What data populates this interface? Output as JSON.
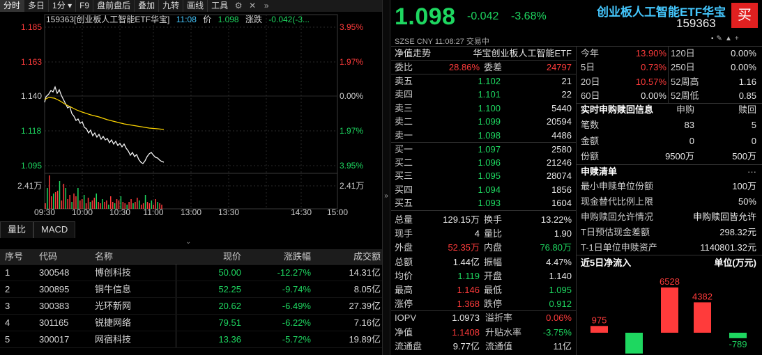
{
  "toolbar": {
    "items": [
      "分时",
      "多日",
      "1分",
      "F9",
      "盘前盘后",
      "叠加",
      "九转",
      "画线",
      "工具"
    ],
    "dropdown_indicator": "▾"
  },
  "chart": {
    "code_name": "159363[创业板人工智能ETF华宝]",
    "time": "11:08",
    "price_label": "价",
    "price_value": "1.098",
    "change_label": "涨跌",
    "change_value": "-0.042(-3...",
    "y_left": [
      "1.185",
      "1.163",
      "1.140",
      "1.118",
      "1.095"
    ],
    "y_right": [
      "3.95%",
      "1.97%",
      "0.00%",
      "1.97%",
      "3.95%"
    ],
    "vol_left": "2.41万",
    "vol_right": "2.41万",
    "x_labels": [
      "09:30",
      "10:00",
      "10:30",
      "11:00",
      "13:00",
      "13:30",
      "14:30",
      "15:00"
    ]
  },
  "indicator_tabs": [
    "量比",
    "MACD"
  ],
  "list": {
    "headers": [
      "序号",
      "代码",
      "名称",
      "现价",
      "涨跌幅",
      "成交额"
    ],
    "rows": [
      {
        "no": "1",
        "code": "300548",
        "name": "博创科技",
        "price": "50.00",
        "chg": "-12.27%",
        "amt": "14.31亿"
      },
      {
        "no": "2",
        "code": "300895",
        "name": "铜牛信息",
        "price": "52.25",
        "chg": "-9.74%",
        "amt": "8.05亿"
      },
      {
        "no": "3",
        "code": "300383",
        "name": "光环新网",
        "price": "20.62",
        "chg": "-6.49%",
        "amt": "27.39亿"
      },
      {
        "no": "4",
        "code": "301165",
        "name": "锐捷网络",
        "price": "79.51",
        "chg": "-6.22%",
        "amt": "7.16亿"
      },
      {
        "no": "5",
        "code": "300017",
        "name": "网宿科技",
        "price": "13.36",
        "chg": "-5.72%",
        "amt": "19.89亿"
      }
    ]
  },
  "quote": {
    "price": "1.098",
    "change": "-0.042",
    "pct": "-3.68%",
    "name": "创业板人工智能ETF华宝",
    "code": "159363",
    "buy_button": "买",
    "meta": "SZSE   CNY   11:08:27   交易中"
  },
  "orderbook": {
    "header_left": "净值走势",
    "header_right": "华宝创业板人工智能ETF",
    "weibi_label": "委比",
    "weibi_value": "28.86%",
    "weicha_label": "委差",
    "weicha_value": "24797",
    "asks": [
      {
        "label": "卖五",
        "price": "1.102",
        "vol": "21"
      },
      {
        "label": "卖四",
        "price": "1.101",
        "vol": "22"
      },
      {
        "label": "卖三",
        "price": "1.100",
        "vol": "5440"
      },
      {
        "label": "卖二",
        "price": "1.099",
        "vol": "20594"
      },
      {
        "label": "卖一",
        "price": "1.098",
        "vol": "4486"
      }
    ],
    "bids": [
      {
        "label": "买一",
        "price": "1.097",
        "vol": "2580"
      },
      {
        "label": "买二",
        "price": "1.096",
        "vol": "21246"
      },
      {
        "label": "买三",
        "price": "1.095",
        "vol": "28074"
      },
      {
        "label": "买四",
        "price": "1.094",
        "vol": "1856"
      },
      {
        "label": "买五",
        "price": "1.093",
        "vol": "1604"
      }
    ]
  },
  "stats": [
    {
      "l1": "总量",
      "v1": "129.15万",
      "c1": "w",
      "l2": "换手",
      "v2": "13.22%",
      "c2": "w"
    },
    {
      "l1": "现手",
      "v1": "4",
      "c1": "w",
      "l2": "量比",
      "v2": "1.90",
      "c2": "w"
    },
    {
      "l1": "外盘",
      "v1": "52.35万",
      "c1": "r",
      "l2": "内盘",
      "v2": "76.80万",
      "c2": "g"
    },
    {
      "l1": "总额",
      "v1": "1.44亿",
      "c1": "w",
      "l2": "振幅",
      "v2": "4.47%",
      "c2": "w"
    },
    {
      "l1": "均价",
      "v1": "1.119",
      "c1": "g",
      "l2": "开盘",
      "v2": "1.140",
      "c2": "w"
    },
    {
      "l1": "最高",
      "v1": "1.146",
      "c1": "r",
      "l2": "最低",
      "v2": "1.095",
      "c2": "g"
    },
    {
      "l1": "涨停",
      "v1": "1.368",
      "c1": "r",
      "l2": "跌停",
      "v2": "0.912",
      "c2": "g"
    }
  ],
  "iopv": [
    {
      "l1": "IOPV",
      "v1": "1.0973",
      "c1": "w",
      "l2": "溢折率",
      "v2": "0.06%",
      "c2": "r"
    },
    {
      "l1": "净值",
      "v1": "1.1408",
      "c1": "r",
      "l2": "升贴水率",
      "v2": "-3.75%",
      "c2": "g"
    },
    {
      "l1": "流通盘",
      "v1": "9.77亿",
      "c1": "w",
      "l2": "流通值",
      "v2": "11亿",
      "c2": "w"
    }
  ],
  "perf": [
    {
      "l1": "今年",
      "v1": "13.90%",
      "c1": "r",
      "l2": "120日",
      "v2": "0.00%",
      "c2": "w"
    },
    {
      "l1": "5日",
      "v1": "0.73%",
      "c1": "r",
      "l2": "250日",
      "v2": "0.00%",
      "c2": "w"
    },
    {
      "l1": "20日",
      "v1": "10.57%",
      "c1": "r",
      "l2": "52周高",
      "v2": "1.16",
      "c2": "w"
    },
    {
      "l1": "60日",
      "v1": "0.00%",
      "c1": "w",
      "l2": "52周低",
      "v2": "0.85",
      "c2": "w"
    }
  ],
  "subscribe": {
    "title": "实时申购赎回信息",
    "col1": "申购",
    "col2": "赎回",
    "rows": [
      {
        "label": "笔数",
        "v1": "83",
        "v2": "5"
      },
      {
        "label": "金额",
        "v1": "0",
        "v2": "0"
      },
      {
        "label": "份额",
        "v1": "9500万",
        "v2": "500万"
      }
    ]
  },
  "creation": {
    "title": "申赎清单",
    "more": "···",
    "rows": [
      {
        "label": "最小申赎单位份额",
        "value": "100万"
      },
      {
        "label": "现金替代比例上限",
        "value": "50%"
      },
      {
        "label": "申购赎回允许情况",
        "value": "申购赎回皆允许"
      },
      {
        "label": "T日预估现金差额",
        "value": "298.32元"
      },
      {
        "label": "T-1日单位申赎资产",
        "value": "1140801.32元"
      }
    ]
  },
  "netflow": {
    "title": "近5日净流入",
    "unit": "单位(万元)",
    "chart_data": {
      "type": "bar",
      "values": [
        975,
        -3000,
        6528,
        4382,
        -789
      ],
      "labels": [
        "975",
        "",
        "6528",
        "4382",
        "-789"
      ]
    }
  },
  "colors": {
    "up": "#ff3b3b",
    "down": "#1ed760",
    "avg": "#ffd700",
    "accent": "#45c8ff"
  }
}
